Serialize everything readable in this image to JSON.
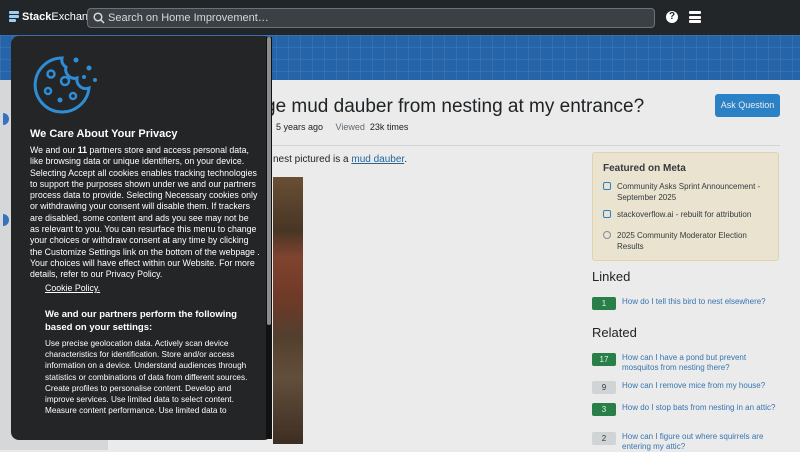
{
  "topbar": {
    "logo_prefix": "Stack",
    "logo_suffix": "Exchange",
    "search_placeholder": "Search on Home Improvement…",
    "help_icon": "help-icon",
    "menu_icon": "site-switcher-icon"
  },
  "question": {
    "title_partial": "ge mud dauber from nesting at my entrance?",
    "asked_ago": "5 years ago",
    "viewed_label": "Viewed",
    "viewed_count": "23k times",
    "ask_button": "Ask Question",
    "body_prefix": "nest pictured is a ",
    "body_link": "mud dauber",
    "body_suffix": "."
  },
  "meta_box": {
    "heading": "Featured on Meta",
    "items": [
      {
        "text": "Community Asks Sprint Announcement - September 2025",
        "icon": "meta-blog-icon"
      },
      {
        "text": "stackoverflow.ai - rebuilt for attribution",
        "icon": "meta-blog-icon"
      },
      {
        "text": "2025 Community Moderator Election Results",
        "icon": "meta-ghost-icon"
      }
    ]
  },
  "linked": {
    "heading": "Linked",
    "items": [
      {
        "score": "1",
        "text": "How do I tell this bird to nest elsewhere?",
        "accepted": true
      }
    ]
  },
  "related": {
    "heading": "Related",
    "items": [
      {
        "score": "17",
        "text": "How can I have a pond but prevent mosquitos from nesting there?",
        "accepted": true
      },
      {
        "score": "9",
        "text": "How can I remove mice from my house?",
        "accepted": false
      },
      {
        "score": "3",
        "text": "How do I stop bats from nesting in an attic?",
        "accepted": true
      },
      {
        "score": "2",
        "text": "How can I figure out where squirrels are entering my attic?",
        "accepted": false
      }
    ]
  },
  "consent": {
    "title": "We Care About Your Privacy",
    "text_a": "We and our ",
    "partner_count": "11",
    "text_b": " partners store and access personal data, like browsing data or unique identifiers, on your device. Selecting Accept all cookies enables tracking technologies to support the purposes shown under we and our partners process data to provide. Selecting Necessary cookies only or withdrawing your consent will disable them. If trackers are disabled, some content and ads you see may not be as relevant to you. You can resurface this menu to change your choices or withdraw consent at any time by clicking the Customize Settings link on the bottom of the webpage . Your choices will have effect within our Website. For more details, refer to our Privacy Policy.",
    "cookie_policy_link": "Cookie Policy.",
    "partners_title": "We and our partners perform the following based on your settings:",
    "partners_text": "Use precise geolocation data. Actively scan device characteristics for identification. Store and/or access information on a device. Understand audiences through statistics or combinations of data from different sources. Create profiles to personalise content. Develop and improve services. Use limited data to select content. Measure content performance. Use limited data to",
    "cookie_icon": "cookie-icon"
  },
  "colors": {
    "topbar": "#232629",
    "banner": "#2a6db8",
    "accent": "#2f8dd6",
    "accepted": "#2d8a4f",
    "consent_bg": "#242526"
  }
}
